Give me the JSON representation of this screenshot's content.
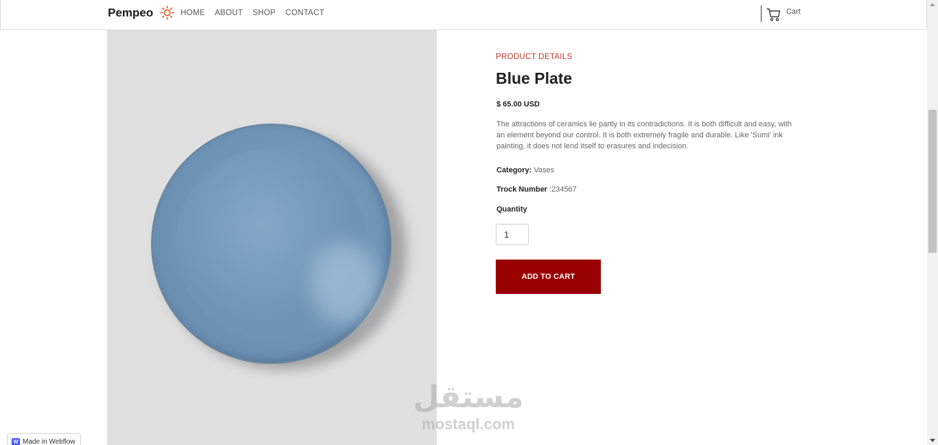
{
  "navbar": {
    "brand": "Pempeo",
    "links": [
      "HOME",
      "ABOUT",
      "SHOP",
      "CONTACT"
    ],
    "cart_label": "Cart"
  },
  "product": {
    "eyebrow": "PRODUCT DETAILS",
    "title": "Blue Plate",
    "price": "$ 65.00 USD",
    "description": "The attractions of ceramics lie partly in its contradictions. It is both difficult and easy, with an element beyond our control. It is both extremely fragile and durable. Like 'Sumi' ink painting, it does not lend itself to erasures and indecision.",
    "category_label": "Category:",
    "category_value": "Vases",
    "track_label": "Trock Number",
    "track_value": ":234567",
    "quantity_label": "Quantity",
    "quantity_value": "1",
    "add_to_cart_label": "ADD TO CART"
  },
  "watermark": {
    "arabic": "مستقل",
    "latin": "mostaql.com"
  },
  "badge": {
    "icon_letter": "W",
    "label": "Made in Webflow"
  },
  "colors": {
    "accent": "#990000",
    "eyebrow": "#c0392b",
    "image_bg": "#e0e0e0",
    "plate": "#7096b8",
    "sun_icon": "#e05a1e"
  }
}
